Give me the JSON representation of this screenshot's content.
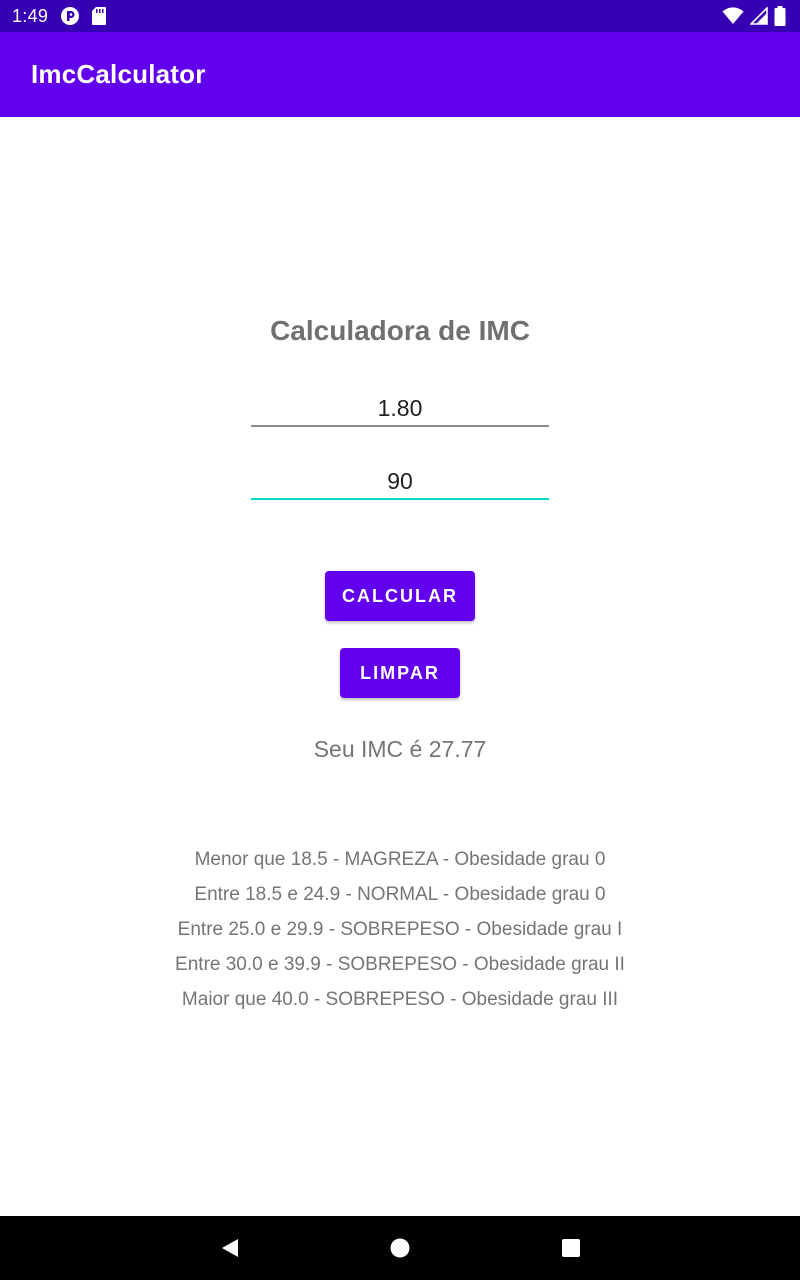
{
  "status_bar": {
    "time": "1:49",
    "icons": [
      "notification-app-icon",
      "sd-card-icon",
      "wifi-icon",
      "signal-icon",
      "battery-icon"
    ]
  },
  "app_bar": {
    "title": "ImcCalculator"
  },
  "main": {
    "title": "Calculadora de IMC",
    "height_field": {
      "value": "1.80"
    },
    "weight_field": {
      "value": "90"
    },
    "calculate_label": "CALCULAR",
    "clear_label": "LIMPAR",
    "result": "Seu IMC é 27.77",
    "reference": [
      "Menor que 18.5 - MAGREZA - Obesidade grau 0",
      "Entre 18.5 e 24.9 - NORMAL - Obesidade grau 0",
      "Entre 25.0 e 29.9 - SOBREPESO - Obesidade grau I",
      "Entre 30.0 e 39.9 - SOBREPESO - Obesidade grau II",
      "Maior que 40.0 - SOBREPESO - Obesidade grau III"
    ]
  },
  "nav_bar": {
    "icons": [
      "back-icon",
      "home-icon",
      "recent-apps-icon"
    ]
  },
  "colors": {
    "status_bar": "#3700b3",
    "primary": "#6200ee",
    "accent": "#03dac5",
    "text_secondary": "#757575"
  }
}
